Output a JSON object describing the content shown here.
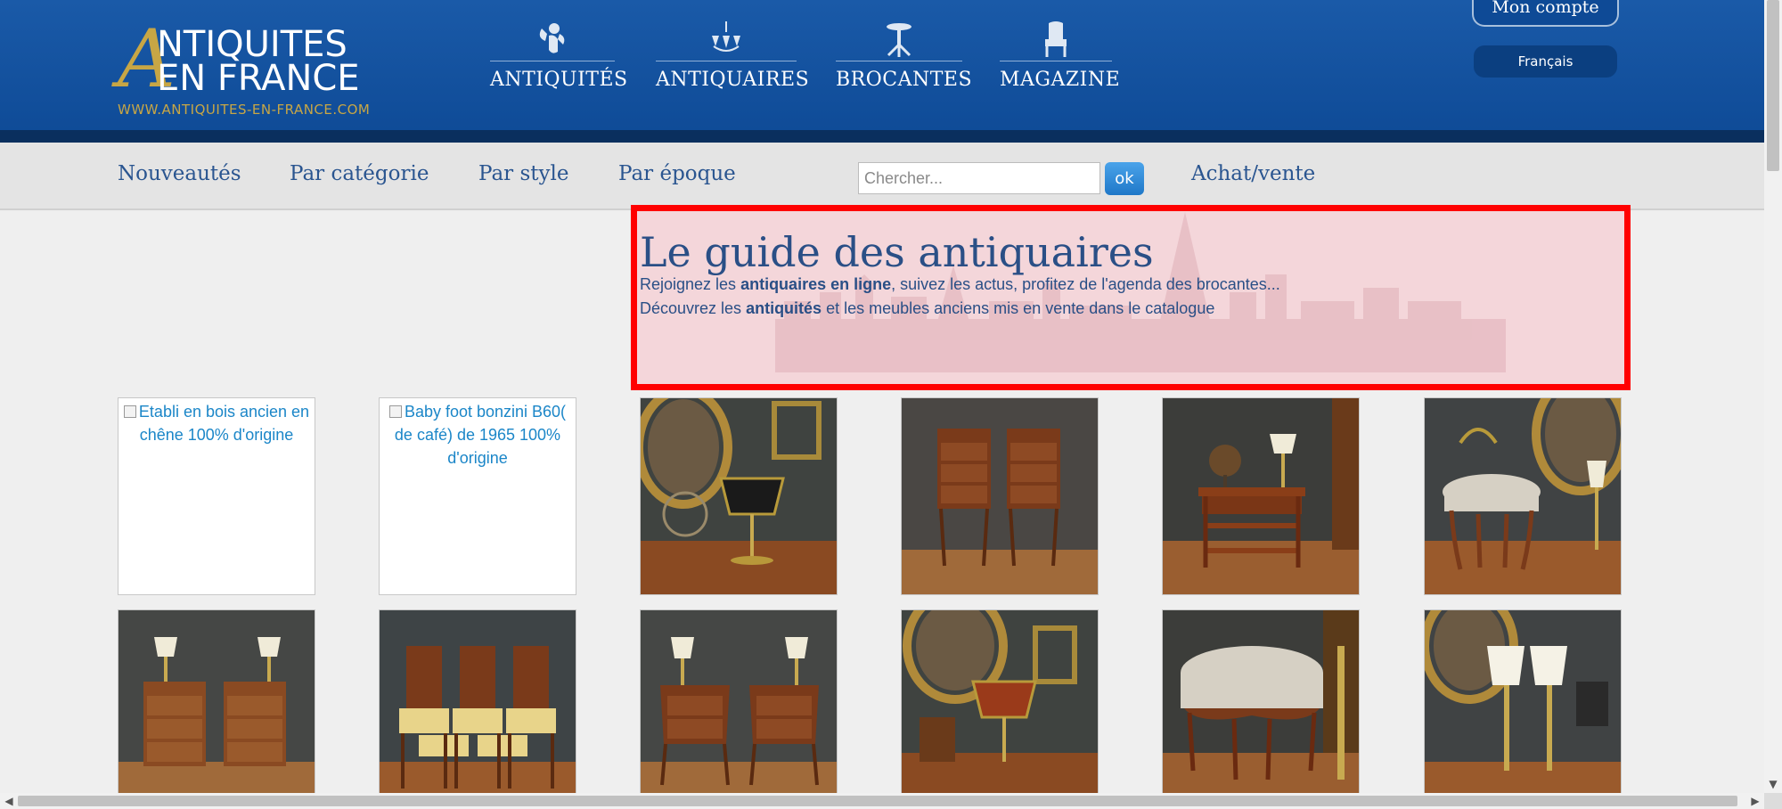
{
  "logo": {
    "line1": "NTIQUITES",
    "line2": "EN FRANCE",
    "letter": "A",
    "url": "WWW.ANTIQUITES-EN-FRANCE.COM"
  },
  "main_nav": [
    {
      "label": "ANTIQUITÉS",
      "icon": "cherub-icon"
    },
    {
      "label": "ANTIQUAIRES",
      "icon": "chandelier-icon"
    },
    {
      "label": "BROCANTES",
      "icon": "pedestal-table-icon"
    },
    {
      "label": "MAGAZINE",
      "icon": "armchair-icon"
    }
  ],
  "account": {
    "label": "Mon compte",
    "language": "Français"
  },
  "sub_nav": {
    "links": [
      "Nouveautés",
      "Par catégorie",
      "Par style",
      "Par époque"
    ],
    "search_placeholder": "Chercher...",
    "search_button": "ok",
    "achat_vente": "Achat/vente"
  },
  "guide": {
    "title": "Le guide des antiquaires",
    "line1_pre": "Rejoignez les ",
    "line1_bold": "antiquaires en ligne",
    "line1_post": ", suivez les actus, profitez de l'agenda des brocantes...",
    "line2_pre": "Découvrez les ",
    "line2_bold": "antiquités",
    "line2_post": " et les meubles anciens mis en vente dans le catalogue"
  },
  "tiles_row1": [
    {
      "alt": "Etabli en bois ancien en chêne 100% d'origine",
      "broken": true
    },
    {
      "alt": "Baby foot bonzini B60( de café) de 1965 100% d'origine",
      "broken": true
    },
    {
      "subject": "bouillotte-lamp-with-portrait"
    },
    {
      "subject": "pair-of-tall-bedside-tables"
    },
    {
      "subject": "small-shelf-table-with-globe"
    },
    {
      "subject": "upholstered-stool-with-lamp"
    }
  ],
  "tiles_row2": [
    {
      "subject": "pair-of-bedside-tables-with-lamps"
    },
    {
      "subject": "set-of-dining-chairs"
    },
    {
      "subject": "pair-of-marquetry-bedside-tables"
    },
    {
      "subject": "bouillotte-lamp-with-portrait"
    },
    {
      "subject": "upholstered-footstool"
    },
    {
      "subject": "pair-of-candlestick-lamps"
    }
  ],
  "colors": {
    "header_blue": "#0e4a96",
    "gold": "#c7a645",
    "nav_link": "#2a5590",
    "highlight": "#ff0000"
  }
}
